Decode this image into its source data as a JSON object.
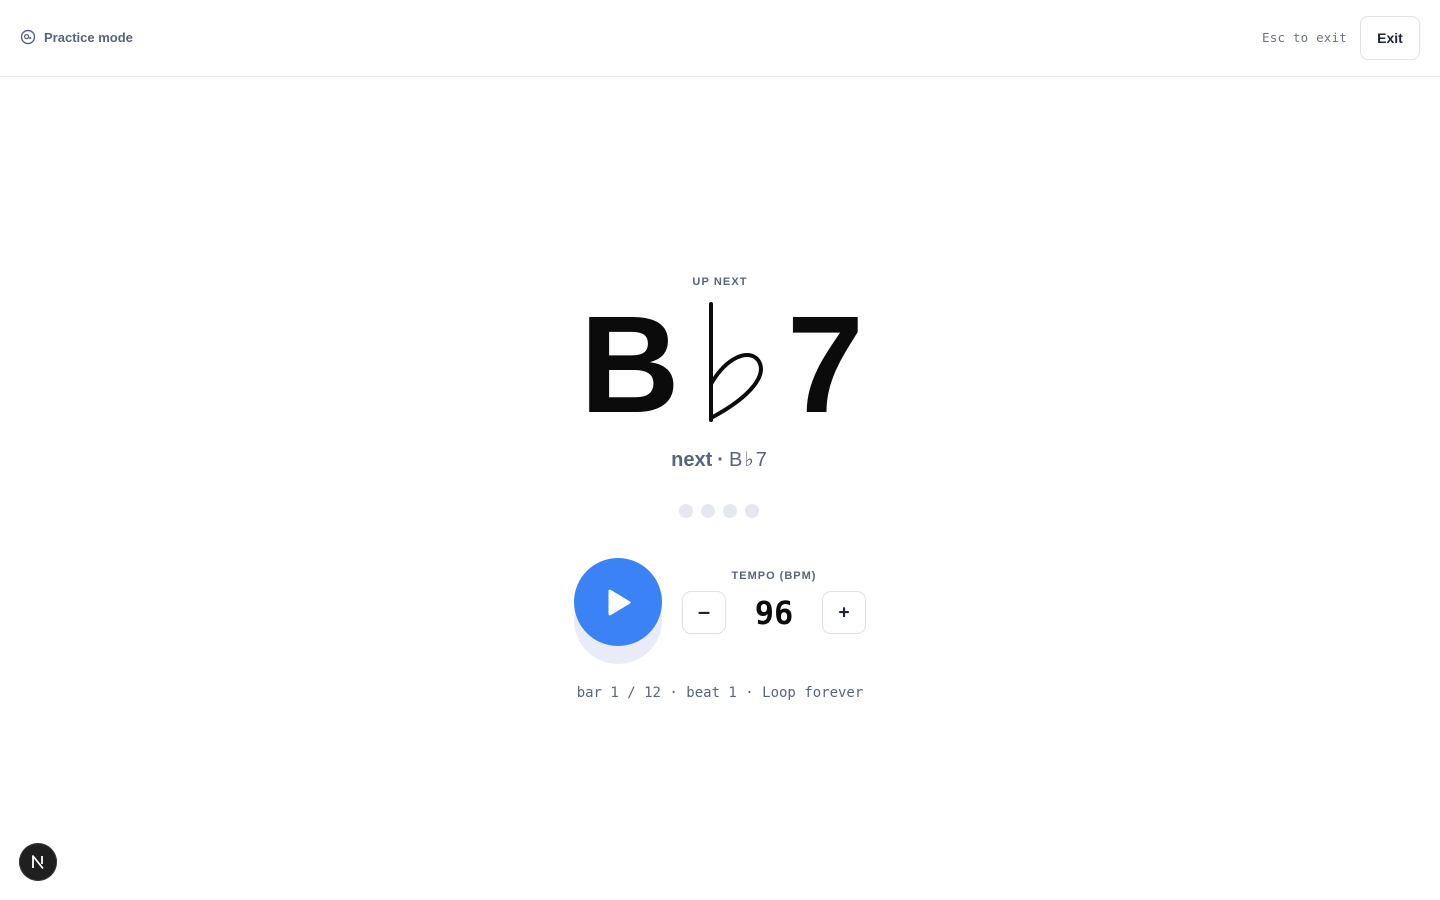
{
  "header": {
    "mode_icon": "metronome-icon",
    "mode_label": "Practice mode",
    "esc_hint": "Esc to exit",
    "exit_label": "Exit"
  },
  "current": {
    "up_next_label": "UP NEXT",
    "chord_root": "B",
    "chord_accidental": "♭",
    "chord_quality": "7"
  },
  "next": {
    "label": "next",
    "separator": "·",
    "chord": "B♭7"
  },
  "beats": {
    "count": 4,
    "active_index": null
  },
  "transport": {
    "play_icon": "play-icon",
    "tempo_label": "TEMPO (BPM)",
    "tempo_value": "96",
    "decrement_label": "–",
    "increment_label": "+"
  },
  "status": {
    "text": "bar 1 / 12 · beat 1 · Loop forever"
  },
  "colors": {
    "accent": "#3b82f6",
    "muted_text": "#5a6478",
    "beat_inactive": "#e6e8f0"
  },
  "dev_badge": {
    "icon": "nextjs-logo-icon",
    "letter": "N"
  }
}
